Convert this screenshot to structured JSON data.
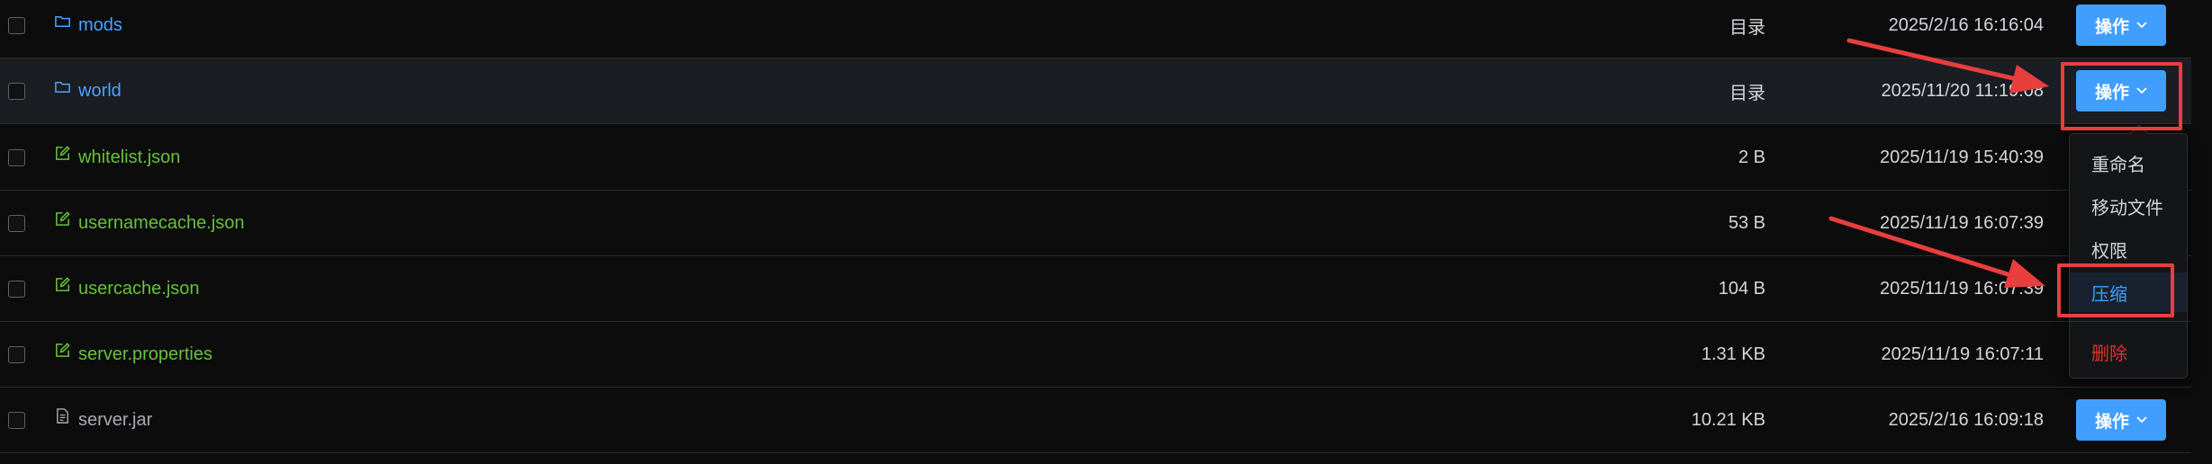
{
  "files": [
    {
      "name": "mods",
      "type": "dir",
      "size": "目录",
      "time": "2025/2/16 16:16:04",
      "action": "操作"
    },
    {
      "name": "world",
      "type": "dir",
      "size": "目录",
      "time": "2025/11/20 11:19:08",
      "action": "操作"
    },
    {
      "name": "whitelist.json",
      "type": "editable",
      "size": "2 B",
      "time": "2025/11/19 15:40:39"
    },
    {
      "name": "usernamecache.json",
      "type": "editable",
      "size": "53 B",
      "time": "2025/11/19 16:07:39"
    },
    {
      "name": "usercache.json",
      "type": "editable",
      "size": "104 B",
      "time": "2025/11/19 16:07:39"
    },
    {
      "name": "server.properties",
      "type": "editable",
      "size": "1.31 KB",
      "time": "2025/11/19 16:07:11"
    },
    {
      "name": "server.jar",
      "type": "plain",
      "size": "10.21 KB",
      "time": "2025/2/16 16:09:18",
      "action": "操作"
    }
  ],
  "dropdown": {
    "items": [
      "重命名",
      "移动文件",
      "权限",
      "压缩",
      "删除"
    ]
  },
  "colors": {
    "folder": "#4aa3ff",
    "editable": "#67c23a",
    "primary_button": "#409eff",
    "danger": "#e0312d",
    "annotation": "#e83e3e"
  }
}
